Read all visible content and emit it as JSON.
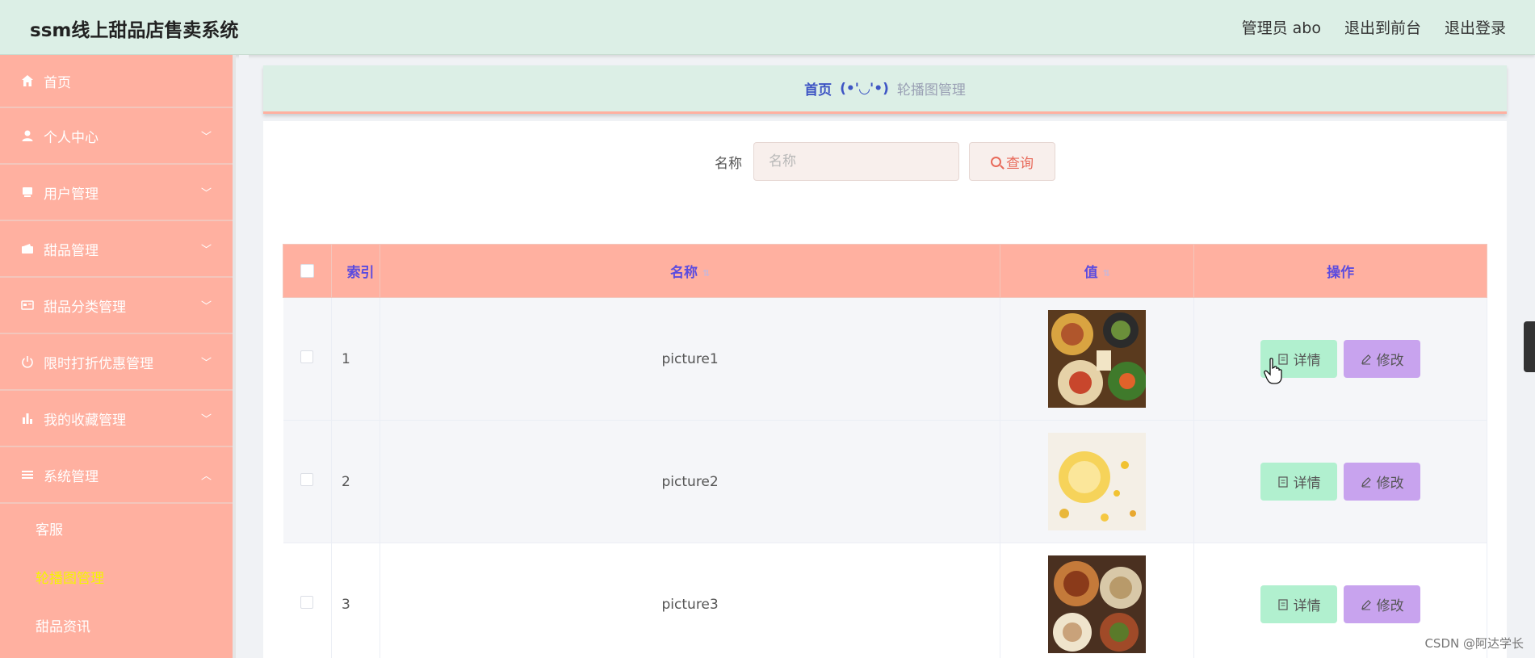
{
  "header": {
    "title": "ssm线上甜品店售卖系统",
    "links": [
      "管理员 abo",
      "退出到前台",
      "退出登录"
    ]
  },
  "sidebar": {
    "items": [
      {
        "label": "首页",
        "icon": "home-icon"
      },
      {
        "label": "个人中心",
        "icon": "user-icon"
      },
      {
        "label": "用户管理",
        "icon": "users-icon"
      },
      {
        "label": "甜品管理",
        "icon": "wallet-icon"
      },
      {
        "label": "甜品分类管理",
        "icon": "card-icon"
      },
      {
        "label": "限时打折优惠管理",
        "icon": "power-icon"
      },
      {
        "label": "我的收藏管理",
        "icon": "bar-chart-icon"
      },
      {
        "label": "系统管理",
        "icon": "menu-icon"
      }
    ],
    "submenu": [
      "客服",
      "轮播图管理",
      "甜品资讯"
    ],
    "active_color": "#f5f500"
  },
  "breadcrumb": {
    "home": "首页",
    "separator": "(•'◡'•)",
    "current": "轮播图管理"
  },
  "search": {
    "label": "名称",
    "placeholder": "名称",
    "button": "查询"
  },
  "table": {
    "headers": {
      "index": "索引",
      "name": "名称",
      "value": "值",
      "actions": "操作"
    },
    "rows": [
      {
        "index": "1",
        "name": "picture1",
        "image": "food-photo-1"
      },
      {
        "index": "2",
        "name": "picture2",
        "image": "food-photo-2"
      },
      {
        "index": "3",
        "name": "picture3",
        "image": "food-photo-3"
      }
    ],
    "actions": {
      "detail": "详情",
      "edit": "修改"
    }
  },
  "watermark": "CSDN @阿达学长",
  "colors": {
    "header_bg": "#dcefe6",
    "sidebar_bg": "#ffb0a0",
    "detail_btn": "#b1f0cf",
    "edit_btn": "#c8a3ee",
    "header_text": "#5b4bdf"
  }
}
